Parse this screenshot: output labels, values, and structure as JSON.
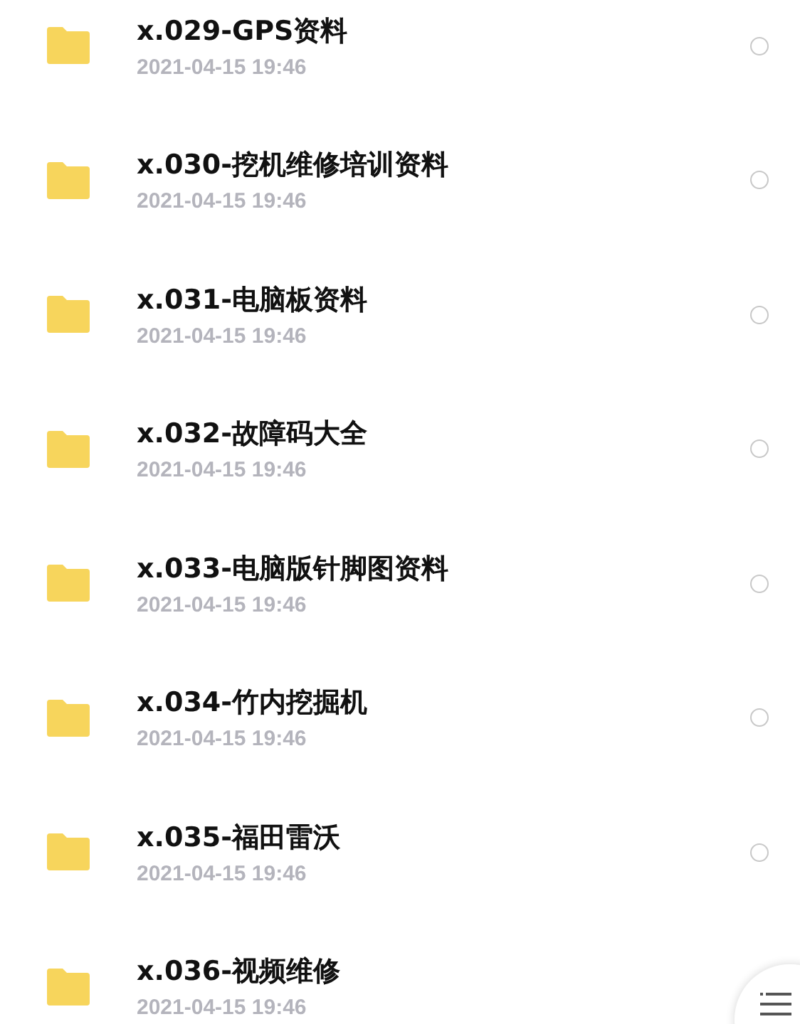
{
  "files": [
    {
      "name": "x.029-GPS资料",
      "date": "2021-04-15 19:46",
      "selected": false
    },
    {
      "name": "x.030-挖机维修培训资料",
      "date": "2021-04-15 19:46",
      "selected": false
    },
    {
      "name": "x.031-电脑板资料",
      "date": "2021-04-15 19:46",
      "selected": false
    },
    {
      "name": "x.032-故障码大全",
      "date": "2021-04-15 19:46",
      "selected": false
    },
    {
      "name": "x.033-电脑版针脚图资料",
      "date": "2021-04-15 19:46",
      "selected": false
    },
    {
      "name": "x.034-竹内挖掘机",
      "date": "2021-04-15 19:46",
      "selected": false
    },
    {
      "name": "x.035-福田雷沃",
      "date": "2021-04-15 19:46",
      "selected": false
    },
    {
      "name": "x.036-视频维修",
      "date": "2021-04-15 19:46"
    }
  ]
}
